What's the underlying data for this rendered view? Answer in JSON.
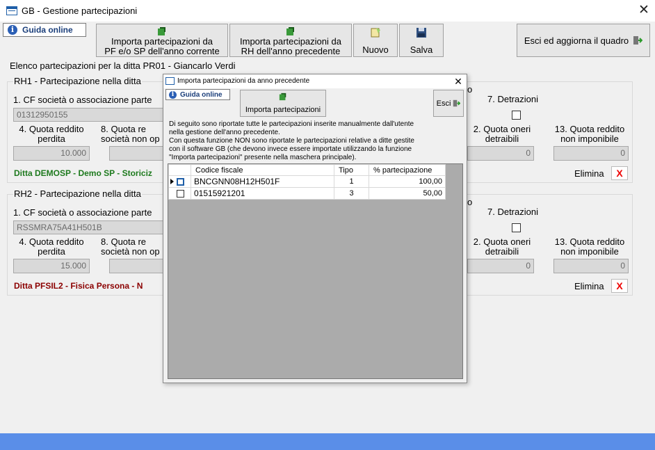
{
  "window": {
    "title": "GB - Gestione partecipazioni",
    "close": "✕"
  },
  "toolbar": {
    "guida": "Guida online",
    "import_pf_line1": "Importa partecipazioni da",
    "import_pf_line2": "PF e/o SP dell'anno corrente",
    "import_rh_line1": "Importa partecipazioni da",
    "import_rh_line2": "RH dell'anno precedente",
    "nuovo": "Nuovo",
    "salva": "Salva",
    "esci": "Esci ed aggiorna il quadro"
  },
  "header": {
    "elenco": "Elenco partecipazioni per la ditta PR01 - Giancarlo Verdi"
  },
  "rh1": {
    "title": "RH1 - Partecipazione nella ditta",
    "cf_label": "1. CF società o associazione parte",
    "cf_value": "01312950155",
    "q4_l1": "4. Quota reddito",
    "q4_l2": "perdita",
    "q4_value": "10.000",
    "q8_l1": "8. Quota re",
    "q8_l2": "società non op",
    "col_partial": "o",
    "det_label": "7. Detrazioni",
    "q12_l1": "2. Quota oneri",
    "q12_l2": "detraibili",
    "q12_value": "0",
    "q13_l1": "13. Quota reddito",
    "q13_l2": "non imponibile",
    "q13_value": "0",
    "ditta": "Ditta DEMOSP - Demo SP - Storiciz",
    "elimina": "Elimina",
    "x": "X"
  },
  "rh2": {
    "title": "RH2 - Partecipazione nella ditta",
    "cf_label": "1. CF società o associazione parte",
    "cf_value": "RSSMRA75A41H501B",
    "q4_l1": "4. Quota reddito",
    "q4_l2": "perdita",
    "q4_value": "15.000",
    "q8_l1": "8. Quota re",
    "q8_l2": "società non op",
    "col_partial": "o",
    "det_label": "7. Detrazioni",
    "q12_l1": "2. Quota oneri",
    "q12_l2": "detraibili",
    "q12_value": "0",
    "q13_l1": "13. Quota reddito",
    "q13_l2": "non imponibile",
    "q13_value": "0",
    "ditta": "Ditta PFSIL2 - Fisica Persona - N",
    "elimina": "Elimina",
    "x": "X"
  },
  "dialog": {
    "title": "Importa partecipazioni da anno precedente",
    "close": "✕",
    "guida": "Guida online",
    "importa": "Importa partecipazioni",
    "esci": "Esci",
    "desc1": "Di seguito sono riportate tutte le partecipazioni inserite manualmente dall'utente",
    "desc2": "nella gestione dell'anno precedente.",
    "desc3": "Con questa funzione NON sono riportate le partecipazioni relative a ditte gestite",
    "desc4": "con il software GB (che devono invece essere importate utilizzando la funzione",
    "desc5": "\"Importa partecipazioni\" presente nella maschera principale).",
    "columns": [
      "Codice fiscale",
      "Tipo",
      "% partecipazione"
    ],
    "rows": [
      {
        "cf": "BNCGNN08H12H501F",
        "tipo": "1",
        "perc": "100,00"
      },
      {
        "cf": "01515921201",
        "tipo": "3",
        "perc": "50,00"
      }
    ]
  },
  "colors": {
    "status_bar": "#5a8ee8",
    "ditta1": "#1e7a1e",
    "ditta2": "#8b0000",
    "delete": "#e00000"
  },
  "icons": [
    "table-icon",
    "info-icon",
    "import-arrow-icon",
    "new-document-icon",
    "floppy-disk-icon",
    "exit-door-icon",
    "checkbox-icon",
    "delete-x-icon"
  ]
}
